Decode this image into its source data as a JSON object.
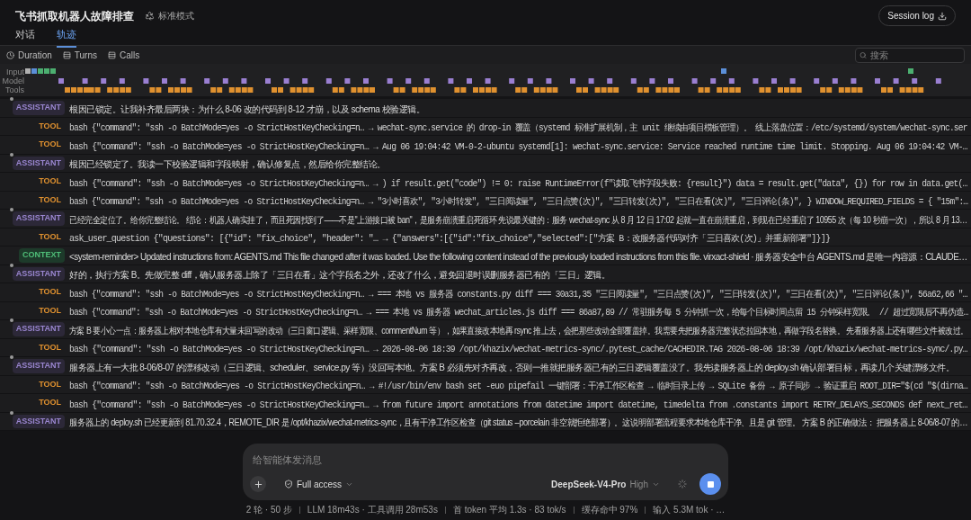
{
  "header": {
    "title": "飞书抓取机器人故障排查",
    "mode": "标准模式",
    "session_button": "Session log"
  },
  "tabs": [
    {
      "label": "对话",
      "selected": false
    },
    {
      "label": "轨迹",
      "selected": true
    }
  ],
  "toolbar": {
    "filters": [
      {
        "kind": "duration",
        "label": "Duration"
      },
      {
        "kind": "turns",
        "label": "Turns"
      },
      {
        "kind": "calls",
        "label": "Calls"
      }
    ],
    "search": {
      "placeholder": "搜索"
    }
  },
  "timeline": {
    "lanes": [
      "Input",
      "Model",
      "Tools"
    ]
  },
  "rows": [
    {
      "kind": "assistant",
      "role": "ASSISTANT",
      "text": "根因已锁定。让我补齐最后两块：为什么 8-06 改的代码到 8-12 才崩，以及 schema 校验逻辑。"
    },
    {
      "kind": "tool",
      "role": "TOOL",
      "text": "bash {\"command\": \"ssh -o BatchMode=yes -o StrictHostKeyChecking=n… → wechat-sync.service 的 drop-in 覆盖（systemd 标准扩展机制，主 unit 继续由项目模板管理）。 线上落盘位置：/etc/systemd/system/wechat-sync.ser"
    },
    {
      "kind": "tool",
      "role": "TOOL",
      "text": "bash {\"command\": \"ssh -o BatchMode=yes -o StrictHostKeyChecking=n… → Aug 06 19:04:42 VM-0-2-ubuntu systemd[1]: wechat-sync.service: Service reached runtime time limit. Stopping. Aug 06 19:04:42 VM-…"
    },
    {
      "kind": "assistant",
      "role": "ASSISTANT",
      "text": "根因已经锁定了。我读一下校验逻辑和字段映射，确认修复点，然后给你完整结论。"
    },
    {
      "kind": "tool",
      "role": "TOOL",
      "text": "bash {\"command\": \"ssh -o BatchMode=yes -o StrictHostKeyChecking=n… → ) if result.get(\"code\") != 0: raise RuntimeError(f\"读取飞书字段失败: {result}\") data = result.get(\"data\", {}) for row in data.get(…"
    },
    {
      "kind": "tool",
      "role": "TOOL",
      "text": "bash {\"command\": \"ssh -o BatchMode=yes -o StrictHostKeyChecking=n… → \"3小时喜欢\", \"3小时转发\", \"三日阅读量\", \"三日点赞(次)\", \"三日转发(次)\", \"三日在看(次)\", \"三日评论(条)\", } WINDOW_REQUIRED_FIELDS = { \"15m\":…"
    },
    {
      "kind": "assistant",
      "role": "ASSISTANT",
      "text": "已经完全定位了。给你完整结论。 结论：机器人确实挂了，而且死因找到了——不是\"上游接口被 ban\"，是服务崩溃重启死循环 先说最关键的：服务 wechat-sync 从 8 月 12 日 17:02 起就一直在崩溃重启，到现在已经重启了 10955 次（每 10 秒崩一次），所以 8 月 13…"
    },
    {
      "kind": "tool",
      "role": "TOOL",
      "text": "ask_user_question {\"questions\": [{\"id\": \"fix_choice\", \"header\": \"… → {\"answers\":[{\"id\":\"fix_choice\",\"selected\":[\"方案 B：改服务器代码对齐「三日喜欢(次)」并重新部署\"]}]}"
    },
    {
      "kind": "context",
      "role": "CONTEXT",
      "text": "<system-reminder> Updated instructions from: AGENTS.md This file changed after it was loaded. Use the following content instead of the previously loaded instructions from this file. virxact-shield · 服务器安全中台 AGENTS.md 是唯一内容源：CLAUDE…"
    },
    {
      "kind": "assistant",
      "role": "ASSISTANT",
      "text": "好的，执行方案 B。先做完整 diff，确认服务器上除了「三日在看」这个字段名之外，还改了什么，避免回退时误删服务器已有的「三日」逻辑。"
    },
    {
      "kind": "tool",
      "role": "TOOL",
      "text": "bash {\"command\": \"ssh -o BatchMode=yes -o StrictHostKeyChecking=n… → === 本地 vs 服务器 constants.py diff === 30a31,35 \"三日阅读量\", \"三日点赞(次)\", \"三日转发(次)\", \"三日在看(次)\", \"三日评论(条)\", 56a62,66 \"…"
    },
    {
      "kind": "tool",
      "role": "TOOL",
      "text": "bash {\"command\": \"ssh -o BatchMode=yes -o StrictHostKeyChecking=n… → === 本地 vs 服务器 wechat_articles.js diff === 86a87,89 // 常驻服务每 5 分钟抓一次，给每个目标时间点留 15 分钟采样宽限。 // 超过宽限后不再伪造…"
    },
    {
      "kind": "assistant",
      "role": "ASSISTANT",
      "text": "方案 B 要小心一点：服务器上相对本地仓库有大量未回写的改动（三日窗口逻辑、采样宽限、commentNum 等），如果直接改本地再 rsync 推上去，会把那些改动全部覆盖掉。我需要先把服务器完整状态拉回本地，再做字段名替换。 先看服务器上还有哪些文件被改过。"
    },
    {
      "kind": "tool",
      "role": "TOOL",
      "text": "bash {\"command\": \"ssh -o BatchMode=yes -o StrictHostKeyChecking=n… → 2026-08-06 18:39 /opt/khazix/wechat-metrics-sync/.pytest_cache/CACHEDIR.TAG 2026-08-06 18:39 /opt/khazix/wechat-metrics-sync/.py…"
    },
    {
      "kind": "assistant",
      "role": "ASSISTANT",
      "text": "服务器上有一大批 8-06/8-07 的漂移改动（三日逻辑、scheduler、service.py 等）没回写本地。方案 B 必须先对齐再改，否则一推就把服务器已有的三日逻辑覆盖没了。我先读服务器上的 deploy.sh 确认部署目标，再读几个关键漂移文件。"
    },
    {
      "kind": "tool",
      "role": "TOOL",
      "text": "bash {\"command\": \"ssh -o BatchMode=yes -o StrictHostKeyChecking=n… → #!/usr/bin/env bash set -euo pipefail 一键部署：干净工作区检查 → 临时目录上传 → SQLite 备份 → 原子同步 → 验证重启 ROOT_DIR=\"$(cd \"$(dirna…"
    },
    {
      "kind": "tool",
      "role": "TOOL",
      "text": "bash {\"command\": \"ssh -o BatchMode=yes -o StrictHostKeyChecking=n… → from future import annotations from datetime import datetime, timedelta from .constants import RETRY_DELAYS_SECONDS def next_ret…"
    },
    {
      "kind": "assistant",
      "role": "ASSISTANT",
      "text": "服务器上的 deploy.sh 已经更新到 81.70.32.4，REMOTE_DIR 是 /opt/khazix/wechat-metrics-sync，且有干净工作区检查（git status --porcelain 非空就拒绝部署）。这说明部署流程要求本地仓库干净、且是 git 管理。 方案 B 的正确做法： 把服务器上 8-06/8-07 的…"
    }
  ],
  "composer": {
    "placeholder": "给智能体发消息",
    "access": "Full access",
    "model": "DeepSeek-V4-Pro",
    "effort": "High"
  },
  "stats": [
    "2 轮 · 50 步",
    "LLM 18m43s · 工具调用 28m53s",
    "首 token 平均 1.3s · 83 tok/s",
    "缓存命中 97%",
    "输入 5.3M tok · …"
  ]
}
